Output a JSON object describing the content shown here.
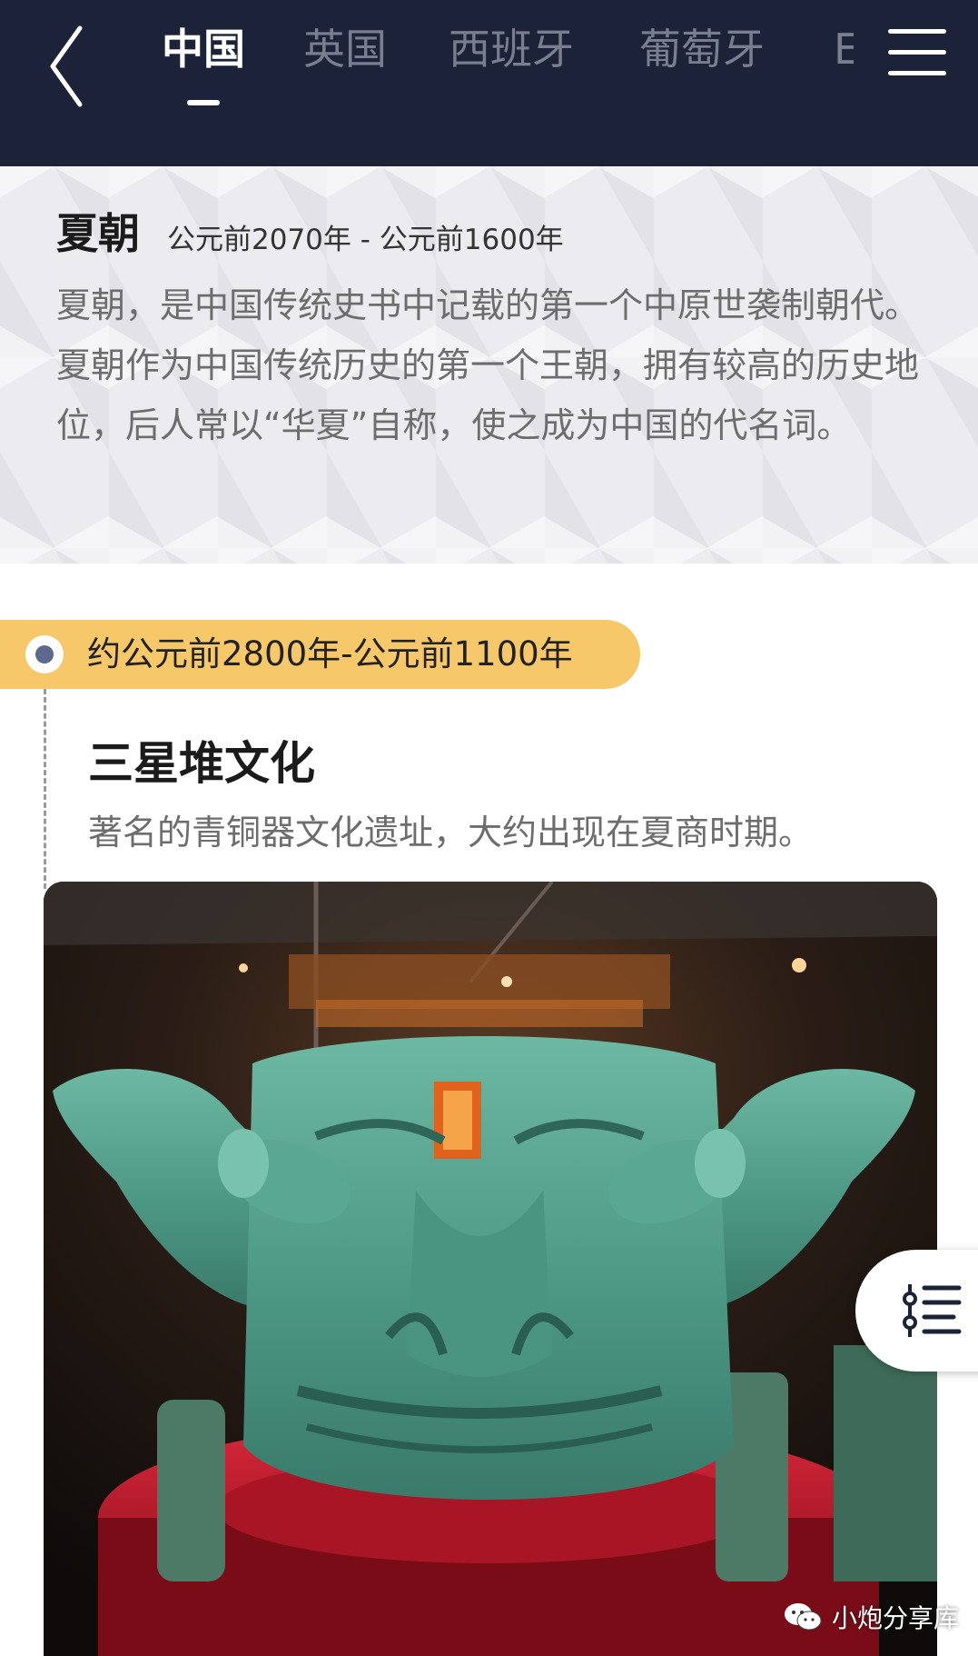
{
  "nav": {
    "tabs": [
      {
        "label": "中国",
        "active": true
      },
      {
        "label": "英国",
        "active": false
      },
      {
        "label": "西班牙",
        "active": false
      },
      {
        "label": "葡萄牙",
        "active": false
      },
      {
        "label": "E",
        "active": false
      }
    ]
  },
  "dynasty": {
    "title": "夏朝",
    "range": "公元前2070年 - 公元前1600年",
    "description": "夏朝，是中国传统史书中记载的第一个中原世袭制朝代。夏朝作为中国传统历史的第一个王朝，拥有较高的历史地位，后人常以“华夏”自称，使之成为中国的代名词。"
  },
  "timeline": {
    "period": "约公元前2800年-公元前1100年",
    "title": "三星堆文化",
    "description": "著名的青铜器文化遗址，大约出现在夏商时期。",
    "image_subject": "bronze-mask-photo"
  },
  "watermark": {
    "text": "小炮分享库",
    "icon": "wechat-icon"
  },
  "colors": {
    "nav_bg": "#1c2238",
    "pill_bg": "#f7c86a",
    "bronze": "#4f9a86"
  }
}
